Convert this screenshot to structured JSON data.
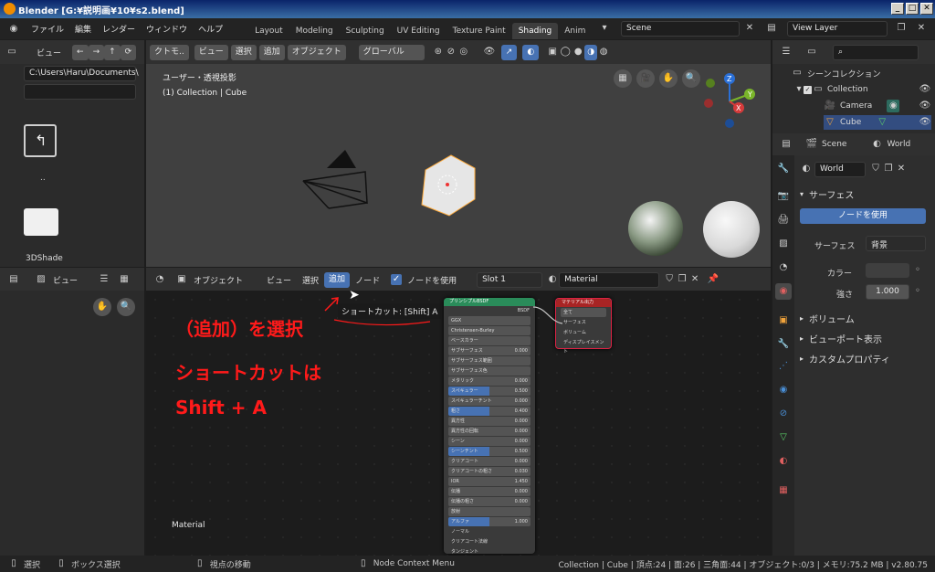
{
  "window": {
    "title": "Blender [G:¥説明画¥10¥s2.blend]"
  },
  "menu": [
    "ファイル",
    "編集",
    "レンダー",
    "ウィンドウ",
    "ヘルプ"
  ],
  "workspaces": [
    "Layout",
    "Modeling",
    "Sculpting",
    "UV Editing",
    "Texture Paint",
    "Shading",
    "Anim"
  ],
  "active_workspace": "Shading",
  "scene_field": "Scene",
  "view_layer_field": "View Layer",
  "filebrowser": {
    "view_label": "ビュー",
    "path": "C:\\Users\\Haru\\Documents\\",
    "parent_label": "..",
    "folder_label": "3DShade"
  },
  "viewport": {
    "header": {
      "mode": "ビュー",
      "select": "選択",
      "add": "追加",
      "object": "オブジェクト",
      "orientation": "グローバル",
      "mode_left": "クトモ.."
    },
    "overlay_title": "ユーザー・透視投影",
    "overlay_sub": "(1) Collection | Cube",
    "gizmo_labels": [
      "Z",
      "Y",
      "X"
    ]
  },
  "node_editor": {
    "header": {
      "mode": "オブジェクト",
      "view": "ビュー",
      "select": "選択",
      "add": "追加",
      "node": "ノード",
      "use_nodes": "ノードを使用",
      "slot": "Slot 1",
      "material": "Material"
    },
    "tooltip": "ショートカット: [Shift] A",
    "footer_label": "Material",
    "bsdf_title": "プリンシプルBSDF",
    "bsdf_output": "BSDF",
    "bsdf_rows": [
      {
        "label": "GGX",
        "value": ""
      },
      {
        "label": "Christensen-Burley",
        "value": ""
      },
      {
        "label": "ベースカラー",
        "value": ""
      },
      {
        "label": "サブサーフェス",
        "value": "0.000"
      },
      {
        "label": "サブサーフェス範囲",
        "value": ""
      },
      {
        "label": "サブサーフェス色",
        "value": ""
      },
      {
        "label": "メタリック",
        "value": "0.000"
      },
      {
        "label": "スペキュラー",
        "value": "0.500"
      },
      {
        "label": "スペキュラーチント",
        "value": "0.000"
      },
      {
        "label": "粗さ",
        "value": "0.400"
      },
      {
        "label": "異方性",
        "value": "0.000"
      },
      {
        "label": "異方性の回転",
        "value": "0.000"
      },
      {
        "label": "シーン",
        "value": "0.000"
      },
      {
        "label": "シーンチント",
        "value": "0.500"
      },
      {
        "label": "クリアコート",
        "value": "0.000"
      },
      {
        "label": "クリアコートの粗さ",
        "value": "0.030"
      },
      {
        "label": "IOR",
        "value": "1.450"
      },
      {
        "label": "伝播",
        "value": "0.000"
      },
      {
        "label": "伝播の粗さ",
        "value": "0.000"
      },
      {
        "label": "放射",
        "value": ""
      },
      {
        "label": "アルファ",
        "value": "1.000"
      },
      {
        "label": "ノーマル",
        "value": ""
      },
      {
        "label": "クリアコート法線",
        "value": ""
      },
      {
        "label": "タンジェント",
        "value": ""
      }
    ],
    "output_title": "マテリアル出力",
    "output_rows": [
      "全て",
      "サーフェス",
      "ボリューム",
      "ディスプレイスメント"
    ]
  },
  "annotations": {
    "line1": "（追加）を選択",
    "line2": "ショートカットは",
    "line3": "Shift + A"
  },
  "outliner": {
    "title": "シーンコレクション",
    "items": [
      {
        "label": "Collection"
      },
      {
        "label": "Camera"
      },
      {
        "label": "Cube"
      }
    ]
  },
  "properties": {
    "scene": "Scene",
    "world": "World",
    "world_field": "World",
    "surface_section": "サーフェス",
    "use_nodes_button": "ノードを使用",
    "surface_label": "サーフェス",
    "surface_value": "背景",
    "color_label": "カラー",
    "strength_label": "強さ",
    "strength_value": "1.000",
    "volume_section": "ボリューム",
    "viewport_section": "ビューポート表示",
    "custom_section": "カスタムプロパティ"
  },
  "statusbar": {
    "select": "選択",
    "box_select": "ボックス選択",
    "move_view": "視点の移動",
    "context_menu": "Node Context Menu",
    "stats": "Collection | Cube | 頂点:24 | 面:26 | 三角面:44 | オブジェクト:0/3 | メモリ:75.2 MB | v2.80.75"
  }
}
